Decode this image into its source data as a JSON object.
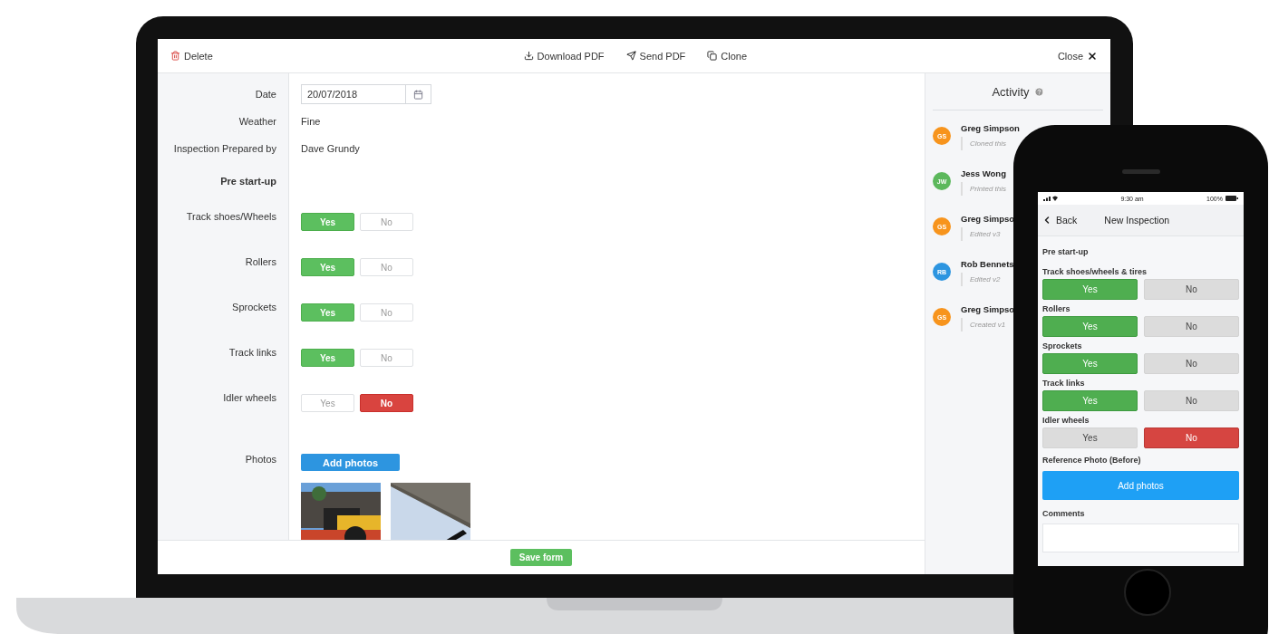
{
  "laptop": {
    "toolbar": {
      "delete": "Delete",
      "actions": [
        {
          "kind": "download",
          "label": "Download PDF"
        },
        {
          "kind": "send",
          "label": "Send PDF"
        },
        {
          "kind": "clone",
          "label": "Clone"
        }
      ],
      "close": "Close"
    },
    "form": [
      {
        "kind": "date",
        "label": "Date",
        "value": "20/07/2018"
      },
      {
        "kind": "text",
        "label": "Weather",
        "value": "Fine"
      },
      {
        "kind": "text",
        "label": "Inspection Prepared by",
        "value": "Dave Grundy"
      },
      {
        "kind": "section",
        "label": "Pre start-up"
      },
      {
        "kind": "yesno",
        "label": "Track shoes/Wheels",
        "options": [
          {
            "label": "Yes",
            "selected": true
          },
          {
            "label": "No",
            "selected": false
          }
        ]
      },
      {
        "kind": "yesno",
        "label": "Rollers",
        "options": [
          {
            "label": "Yes",
            "selected": true
          },
          {
            "label": "No",
            "selected": false
          }
        ]
      },
      {
        "kind": "yesno",
        "label": "Sprockets",
        "options": [
          {
            "label": "Yes",
            "selected": true
          },
          {
            "label": "No",
            "selected": false
          }
        ]
      },
      {
        "kind": "yesno",
        "label": "Track links",
        "options": [
          {
            "label": "Yes",
            "selected": true
          },
          {
            "label": "No",
            "selected": false
          }
        ]
      },
      {
        "kind": "yesno",
        "label": "Idler wheels",
        "options": [
          {
            "label": "Yes",
            "selected": false
          },
          {
            "label": "No",
            "selected": true
          }
        ]
      },
      {
        "kind": "photos",
        "label": "Photos",
        "button": "Add photos"
      }
    ],
    "save": "Save form",
    "activity": {
      "title": "Activity",
      "entries": [
        {
          "initials": "GS",
          "color": "#f7941d",
          "name": "Greg Simpson",
          "action": "Cloned this"
        },
        {
          "initials": "JW",
          "color": "#5cb85c",
          "name": "Jess Wong",
          "action": "Printed this"
        },
        {
          "initials": "GS",
          "color": "#f7941d",
          "name": "Greg Simpso",
          "action": "Edited v3"
        },
        {
          "initials": "RB",
          "color": "#2d95e0",
          "name": "Rob Bennets",
          "action": "Edited v2"
        },
        {
          "initials": "GS",
          "color": "#f7941d",
          "name": "Greg Simpso",
          "action": "Created v1"
        }
      ]
    }
  },
  "phone": {
    "status": {
      "time": "9:30 am",
      "battery": "100%"
    },
    "nav": {
      "back": "Back",
      "title": "New Inspection"
    },
    "section": "Pre start-up",
    "questions": [
      {
        "label": "Track shoes/wheels & tires",
        "options": [
          {
            "label": "Yes",
            "selected": true
          },
          {
            "label": "No",
            "selected": false
          }
        ]
      },
      {
        "label": "Rollers",
        "options": [
          {
            "label": "Yes",
            "selected": true
          },
          {
            "label": "No",
            "selected": false
          }
        ]
      },
      {
        "label": "Sprockets",
        "options": [
          {
            "label": "Yes",
            "selected": true
          },
          {
            "label": "No",
            "selected": false
          }
        ]
      },
      {
        "label": "Track links",
        "options": [
          {
            "label": "Yes",
            "selected": true
          },
          {
            "label": "No",
            "selected": false
          }
        ]
      },
      {
        "label": "Idler wheels",
        "options": [
          {
            "label": "Yes",
            "selected": false
          },
          {
            "label": "No",
            "selected": true
          }
        ]
      }
    ],
    "photo_label": "Reference Photo (Before)",
    "photo_button": "Add photos",
    "comments_label": "Comments"
  }
}
